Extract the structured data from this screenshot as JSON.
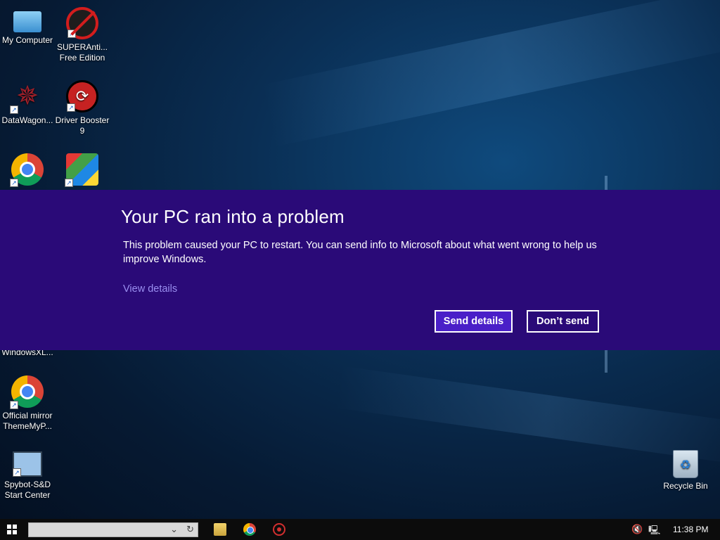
{
  "desktop": {
    "icons": [
      {
        "label": "My Computer",
        "icon": "computer-icon"
      },
      {
        "label": "SUPERAnti... Free Edition",
        "icon": "superantispyware-icon"
      },
      {
        "label": "DataWagon...",
        "icon": "datawagon-icon"
      },
      {
        "label": "Driver Booster 9",
        "icon": "driver-booster-icon"
      },
      {
        "label": "",
        "icon": "chrome-icon"
      },
      {
        "label": "",
        "icon": "avg-icon"
      },
      {
        "label": "WindowsXL...",
        "icon": "hidden-icon"
      },
      {
        "label": "Official mirror ThemeMyP...",
        "icon": "chrome-icon"
      },
      {
        "label": "Spybot-S&D Start Center",
        "icon": "spybot-icon"
      },
      {
        "label": "Recycle Bin",
        "icon": "recycle-bin-icon"
      }
    ]
  },
  "dialog": {
    "title": "Your PC ran into a problem",
    "body": "This problem caused your PC to restart. You can send info to Microsoft about what went wrong to help us improve Windows.",
    "view_details": "View details",
    "send_button": "Send details",
    "dont_send_button": "Don’t send",
    "background_color": "#2a0a78"
  },
  "taskbar": {
    "search_value": "",
    "clock": "11:38 PM",
    "apps": [
      "file-explorer-icon",
      "chrome-icon",
      "driver-booster-icon"
    ]
  }
}
